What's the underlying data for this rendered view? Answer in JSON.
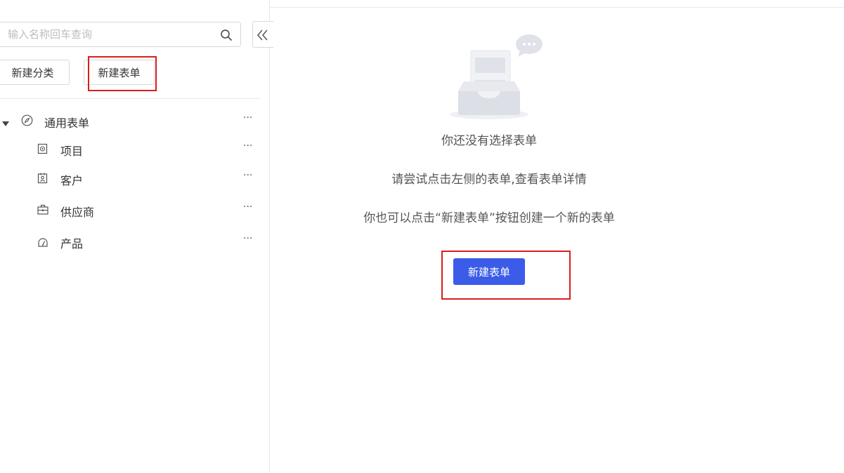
{
  "sidebar": {
    "search_placeholder": "输入名称回车查询",
    "new_category_label": "新建分类",
    "new_form_label": "新建表单",
    "tree": {
      "group_label": "通用表单",
      "items": [
        {
          "label": "项目",
          "icon": "project-icon"
        },
        {
          "label": "客户",
          "icon": "customer-icon"
        },
        {
          "label": "供应商",
          "icon": "supplier-icon"
        },
        {
          "label": "产品",
          "icon": "product-icon"
        }
      ],
      "more_label": "···"
    }
  },
  "main": {
    "empty_title": "你还没有选择表单",
    "hint_1": "请尝试点击左侧的表单,查看表单详情",
    "hint_2": "你也可以点击“新建表单”按钮创建一个新的表单",
    "new_form_label": "新建表单"
  },
  "colors": {
    "primary": "#3a5ce8",
    "highlight_box": "#d81e1e",
    "border": "#d9d9d9"
  }
}
